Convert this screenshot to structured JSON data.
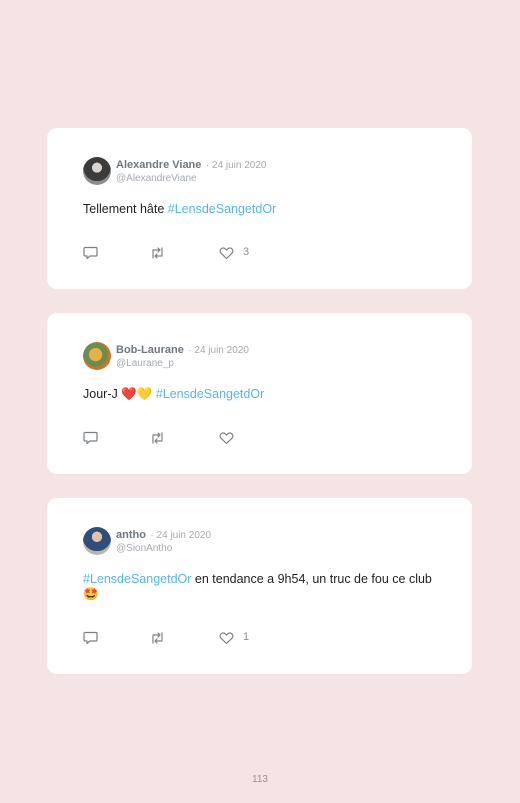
{
  "tweets": [
    {
      "name": "Alexandre Viane",
      "date": "· 24 juin 2020",
      "handle": "@AlexandreViane",
      "text_before": "Tellement hâte ",
      "hashtag": "#LensdeSangetdOr",
      "text_after": "",
      "likes": "3"
    },
    {
      "name": "Bob-Laurane",
      "date": "· 24 juin 2020",
      "handle": "@Laurane_p",
      "text_before": "Jour-J ❤️💛 ",
      "hashtag": "#LensdeSangetdOr",
      "text_after": "",
      "likes": ""
    },
    {
      "name": "antho",
      "date": "· 24 juin 2020",
      "handle": "@SionAntho",
      "text_before": "",
      "hashtag": "#LensdeSangetdOr",
      "text_after": " en tendance a 9h54, un truc de fou ce club 🤩",
      "likes": "1"
    }
  ],
  "icons": {
    "reply": "reply-icon",
    "retweet": "retweet-icon",
    "like": "heart-icon"
  },
  "colors": {
    "background": "#f5e4e3",
    "card": "#ffffff",
    "hashtag": "#58b4e8",
    "name": "#6f7780",
    "muted": "#a4aab1"
  },
  "page_number": "113"
}
